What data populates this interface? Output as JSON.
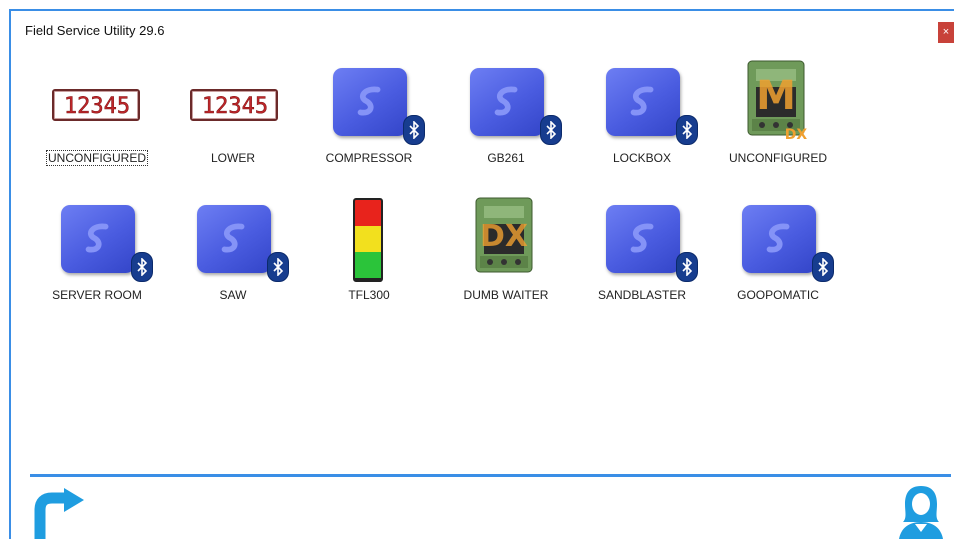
{
  "window": {
    "title": "Field Service Utility 29.6",
    "close_label": "×"
  },
  "devices": [
    {
      "label": "UNCONFIGURED",
      "icon": "led-counter-icon"
    },
    {
      "label": "LOWER",
      "icon": "led-counter-icon"
    },
    {
      "label": "COMPRESSOR",
      "icon": "bluetooth-sensor-icon"
    },
    {
      "label": "GB261",
      "icon": "bluetooth-sensor-icon"
    },
    {
      "label": "LOCKBOX",
      "icon": "bluetooth-sensor-icon"
    },
    {
      "label": "UNCONFIGURED",
      "icon": "din-rail-module-icon"
    },
    {
      "label": "SERVER ROOM",
      "icon": "bluetooth-sensor-icon"
    },
    {
      "label": "SAW",
      "icon": "bluetooth-sensor-icon"
    },
    {
      "label": "TFL300",
      "icon": "traffic-light-icon"
    },
    {
      "label": "DUMB WAITER",
      "icon": "din-rail-module-icon"
    },
    {
      "label": "SANDBLASTER",
      "icon": "bluetooth-sensor-icon"
    },
    {
      "label": "GOOPOMATIC",
      "icon": "bluetooth-sensor-icon"
    }
  ],
  "led_digits": "12345",
  "din_overlay_text": "DX",
  "din_overlay_big": "M",
  "colors": {
    "accent": "#3a8ee6",
    "sensor_blue": "#4a5ce0",
    "led_red": "#c0262a",
    "din_green": "#6f9a5a",
    "overlay_orange": "#f0a030"
  }
}
